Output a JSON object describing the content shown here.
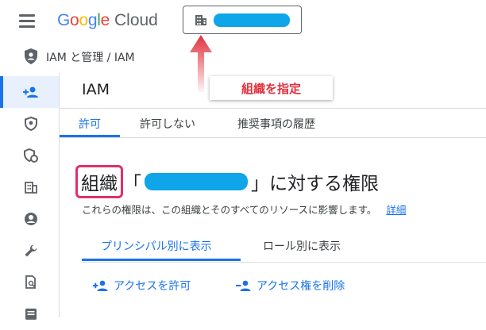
{
  "header": {
    "logo_text": "Google",
    "logo_suffix": "Cloud"
  },
  "callout": {
    "label": "組織を指定"
  },
  "breadcrumb": {
    "text": "IAM と管理 / IAM"
  },
  "sidebar": {
    "items": [
      {
        "icon": "person-add-icon",
        "active": true
      },
      {
        "icon": "shield-icon"
      },
      {
        "icon": "shield-settings-icon"
      },
      {
        "icon": "building-icon"
      },
      {
        "icon": "account-circle-icon"
      },
      {
        "icon": "wrench-icon"
      },
      {
        "icon": "document-search-icon"
      },
      {
        "icon": "list-icon"
      }
    ]
  },
  "main": {
    "title": "IAM",
    "tabs": [
      "許可",
      "許可しない",
      "推奨事項の履歴"
    ],
    "heading_org": "組織",
    "heading_open": "「",
    "heading_close": "」に対する権限",
    "description": "これらの権限は、この組織とそのすべてのリソースに影響します。",
    "details_link": "詳細",
    "view_tabs": [
      "プリンシパル別に表示",
      "ロール別に表示"
    ],
    "actions": [
      "アクセスを許可",
      "アクセス権を削除"
    ]
  },
  "colors": {
    "accent": "#1a73e8",
    "redaction": "#0ea5e9",
    "annotation": "#e0303c",
    "highlight_border": "#e0306a"
  }
}
